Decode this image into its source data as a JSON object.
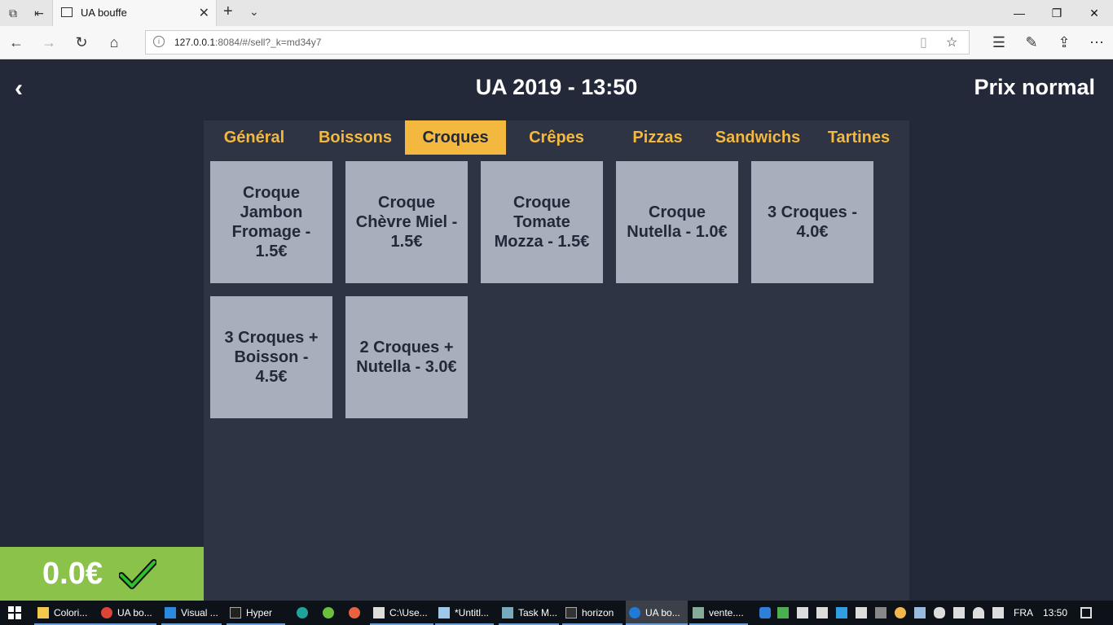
{
  "browser": {
    "tab_title": "UA bouffe",
    "url_host": "127.0.0.1",
    "url_rest": ":8084/#/sell?_k=md34y7",
    "icons": [
      "tab-actions-icon",
      "set-aside-tabs-icon",
      "new-tab-icon",
      "tab-list-icon",
      "minimize-icon",
      "restore-icon",
      "close-icon",
      "back-icon",
      "forward-icon",
      "refresh-icon",
      "home-icon",
      "reading-view-icon",
      "favorite-star-icon",
      "favorites-hub-icon",
      "pen-icon",
      "share-icon",
      "more-icon"
    ]
  },
  "header": {
    "back_glyph": "‹",
    "title": "UA 2019 - 13:50",
    "price_mode": "Prix normal"
  },
  "categories": [
    "Général",
    "Boissons",
    "Croques",
    "Crêpes",
    "Pizzas",
    "Sandwichs",
    "Tartines"
  ],
  "active_category": "Croques",
  "products": [
    "Croque Jambon Fromage - 1.5€",
    "Croque Chèvre Miel - 1.5€",
    "Croque Tomate Mozza - 1.5€",
    "Croque Nutella - 1.0€",
    "3 Croques - 4.0€",
    "3 Croques + Boisson - 4.5€",
    "2 Croques + Nutella - 3.0€"
  ],
  "total": {
    "value": "0.0€",
    "icon": "checkmark-icon"
  },
  "taskbar": {
    "items": [
      "Colori...",
      "UA bo...",
      "Visual ...",
      "Hyper",
      "C:\\Use...",
      "*Untitl...",
      "Task M...",
      "horizon",
      "UA bo...",
      "vente...."
    ],
    "language": "FRA",
    "clock": "13:50"
  },
  "colors": {
    "background": "#232939",
    "panel": "#2e3444",
    "accent": "#f3b83e",
    "product_tile": "#a8afbc",
    "total_green": "#8bc34a"
  }
}
